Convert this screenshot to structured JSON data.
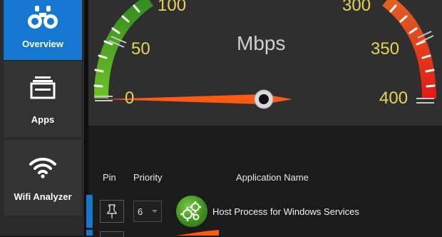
{
  "sidebar": {
    "items": [
      {
        "label": "Overview",
        "icon": "binoculars-icon",
        "active": true
      },
      {
        "label": "Apps",
        "icon": "apps-window-icon",
        "active": false
      },
      {
        "label": "Wifi Analyzer",
        "icon": "wifi-icon",
        "active": false
      }
    ]
  },
  "gauge": {
    "unit": "Mbps",
    "ticks": [
      "0",
      "50",
      "100",
      "300",
      "350",
      "400"
    ],
    "value": 0,
    "max": 400
  },
  "table": {
    "headers": {
      "pin": "Pin",
      "priority": "Priority",
      "app_name": "Application Name"
    },
    "rows": [
      {
        "priority": "6",
        "name": "Host Process for Windows Services",
        "icon": "gears-icon"
      }
    ]
  },
  "colors": {
    "accent": "#1577cf",
    "needle": "#ff5a14",
    "gauge_green": "#5aa823",
    "gauge_red": "#e0231c"
  }
}
